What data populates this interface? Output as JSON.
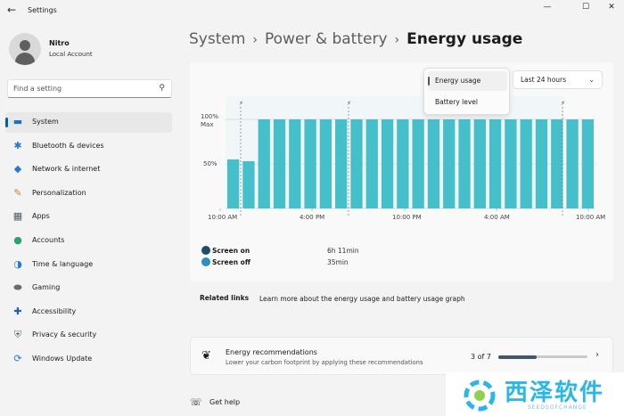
{
  "app": {
    "title": "Settings"
  },
  "window_controls": {
    "minimize": "—",
    "maximize": "☐",
    "close": "✕"
  },
  "user": {
    "name": "Nitro",
    "account": "Local Account"
  },
  "search": {
    "placeholder": "Find a setting"
  },
  "sidebar": {
    "items": [
      {
        "label": "System",
        "icon": "monitor-icon",
        "glyph": "▬",
        "color": "#1d6fd1",
        "active": true
      },
      {
        "label": "Bluetooth & devices",
        "icon": "bluetooth-icon",
        "glyph": "✱",
        "color": "#1f7ad8"
      },
      {
        "label": "Network & internet",
        "icon": "wifi-icon",
        "glyph": "◆",
        "color": "#1f7ad8"
      },
      {
        "label": "Personalization",
        "icon": "brush-icon",
        "glyph": "✎",
        "color": "#d67a2c"
      },
      {
        "label": "Apps",
        "icon": "apps-icon",
        "glyph": "▦",
        "color": "#555b66"
      },
      {
        "label": "Accounts",
        "icon": "person-icon",
        "glyph": "●",
        "color": "#2ba36b"
      },
      {
        "label": "Time & language",
        "icon": "globe-clock-icon",
        "glyph": "◑",
        "color": "#1f7ad8"
      },
      {
        "label": "Gaming",
        "icon": "gamepad-icon",
        "glyph": "⬬",
        "color": "#6b6b6b"
      },
      {
        "label": "Accessibility",
        "icon": "accessibility-icon",
        "glyph": "✚",
        "color": "#1f5fb8"
      },
      {
        "label": "Privacy & security",
        "icon": "shield-icon",
        "glyph": "⛨",
        "color": "#6b6b6b"
      },
      {
        "label": "Windows Update",
        "icon": "update-icon",
        "glyph": "⟳",
        "color": "#1f7ad8"
      }
    ]
  },
  "breadcrumb": {
    "part1": "System",
    "part2": "Power & battery",
    "current": "Energy usage",
    "separator": "›"
  },
  "view_menu": {
    "items": [
      "Energy usage",
      "Battery level"
    ],
    "selected": "Energy usage"
  },
  "range_select": {
    "value": "Last 24 hours"
  },
  "chart_data": {
    "type": "bar",
    "bar_color": "#45bfc9",
    "y_ticks": [
      "100%\nMax",
      "50%"
    ],
    "ylim": [
      0,
      100
    ],
    "x_tick_labels": [
      "10:00 AM",
      "4:00 PM",
      "10:00 PM",
      "4:00 AM",
      "10:00 AM"
    ],
    "charging_markers": [
      "⚡",
      "⚡",
      "⚡"
    ],
    "values": [
      55,
      53,
      100,
      100,
      100,
      100,
      100,
      100,
      100,
      100,
      100,
      100,
      100,
      100,
      100,
      100,
      100,
      100,
      100,
      100,
      100,
      100,
      100,
      100
    ]
  },
  "legend": {
    "screen_on": {
      "label": "Screen on",
      "value": "6h 11min",
      "color": "#1f4e6b"
    },
    "screen_off": {
      "label": "Screen off",
      "value": "35min",
      "color": "#2c8fc0"
    }
  },
  "related": {
    "title": "Related links",
    "link": "Learn more about the energy usage and battery usage graph"
  },
  "recommendations": {
    "title": "Energy recommendations",
    "subtitle": "Lower your carbon footprint by applying these recommendations",
    "count": "3 of 7",
    "progress": 0.43
  },
  "help": {
    "label": "Get help"
  },
  "watermark": {
    "text": "西泽软件",
    "sub": "SEEDSOFCHANGE"
  }
}
